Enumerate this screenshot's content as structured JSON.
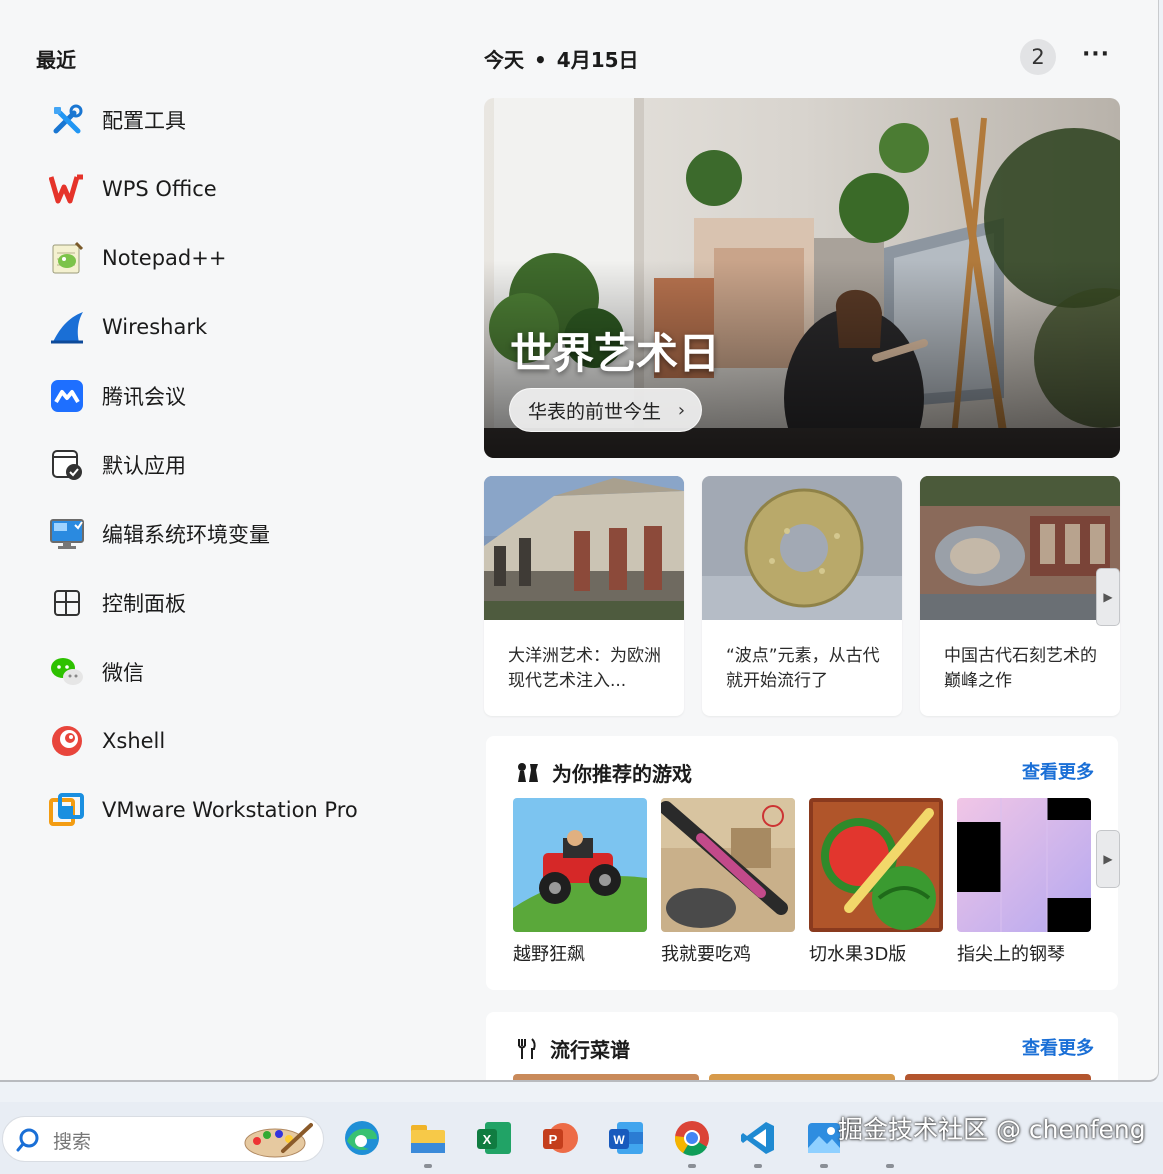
{
  "recent": {
    "title": "最近",
    "apps": [
      {
        "label": "配置工具",
        "icon": "tools-icon"
      },
      {
        "label": "WPS Office",
        "icon": "wps-icon"
      },
      {
        "label": "Notepad++",
        "icon": "notepad-plus-plus-icon"
      },
      {
        "label": "Wireshark",
        "icon": "wireshark-fin-icon"
      },
      {
        "label": "腾讯会议",
        "icon": "tencent-meeting-icon"
      },
      {
        "label": "默认应用",
        "icon": "default-apps-icon"
      },
      {
        "label": "编辑系统环境变量",
        "icon": "monitor-settings-icon"
      },
      {
        "label": "控制面板",
        "icon": "control-panel-icon"
      },
      {
        "label": "微信",
        "icon": "wechat-icon"
      },
      {
        "label": "Xshell",
        "icon": "xshell-icon"
      },
      {
        "label": "VMware Workstation Pro",
        "icon": "vmware-icon"
      }
    ]
  },
  "header": {
    "today": "今天",
    "separator": "•",
    "date": "4月15日",
    "badge_count": "2",
    "more": "···"
  },
  "hero": {
    "title": "世界艺术日",
    "pill_label": "华表的前世今生",
    "pill_chevron": "›"
  },
  "cards": [
    {
      "caption": "大洋洲艺术：为欧洲现代艺术注入...",
      "image": "colonial-building-photo"
    },
    {
      "caption": "“波点”元素，从古代就开始流行了",
      "image": "jade-disc-photo"
    },
    {
      "caption": "中国古代石刻艺术的巅峰之作",
      "image": "stone-carving-photo"
    }
  ],
  "games": {
    "title": "为你推荐的游戏",
    "see_more": "查看更多",
    "items": [
      {
        "name": "越野狂飙"
      },
      {
        "name": "我就要吃鸡"
      },
      {
        "name": "切水果3D版"
      },
      {
        "name": "指尖上的钢琴"
      }
    ]
  },
  "recipes": {
    "title": "流行菜谱",
    "see_more": "查看更多"
  },
  "taskbar": {
    "search_placeholder": "搜索",
    "icons": [
      "edge-icon",
      "file-explorer-icon",
      "excel-icon",
      "powerpoint-icon",
      "word-icon",
      "chrome-icon",
      "vscode-icon",
      "photos-icon"
    ]
  },
  "watermark": "掘金技术社区 @ chenfeng",
  "colors": {
    "accent_link": "#1a6fd6",
    "panel_bg": "#f6f7f8",
    "taskbar_bg": "#e8edf4"
  }
}
